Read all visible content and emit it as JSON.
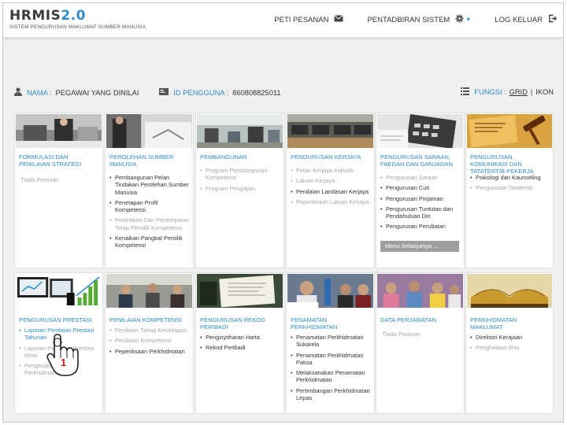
{
  "header": {
    "logo_main": "HRMIS",
    "logo_ver": "2.0",
    "logo_sub": "SISTEM PENGURUSAN MAKLUMAT SUMBER MANUSIA",
    "nav": [
      {
        "label": "PETI PESANAN",
        "icon": "envelope-icon"
      },
      {
        "label": "PENTADBIRAN SISTEM",
        "icon": "gear-icon"
      },
      {
        "label": "LOG KELUAR",
        "icon": "logout-icon"
      }
    ]
  },
  "info": {
    "name_label": "NAMA :",
    "name_value": "PEGAWAI YANG DINILAI",
    "id_label": "ID PENGGUNA :",
    "id_value": "860808825011",
    "function_label": "FUNGSI :",
    "grid_label": "GRID",
    "separator": "|",
    "icon_label": "IKON"
  },
  "colors": {
    "accent": "#2d8cc8",
    "dim_text": "#a6a6a6",
    "background": "#f0f0f0"
  },
  "cards": [
    {
      "title": "FORMULASI DAN PENILAIAN STRATEGI",
      "none": "Tiada Peranan",
      "items": []
    },
    {
      "title": "PEROLEHAN SUMBER MANUSIA",
      "items": [
        {
          "label": "Pembangunan Pelan Tindakan Perolehan Sumber Manusia",
          "dim": false
        },
        {
          "label": "Penetapan Profil Kompetensi",
          "dim": false
        },
        {
          "label": "Pelantikan Dan Penempatan Tetap Pemilik Kompetensi",
          "dim": true
        },
        {
          "label": "Kenaikan Pangkat Pemilik Kompetensi",
          "dim": false
        }
      ]
    },
    {
      "title": "PEMBANGUNAN",
      "items": [
        {
          "label": "Program Pembangunan Kompetensi",
          "dim": true
        },
        {
          "label": "Program Pengajian",
          "dim": true
        }
      ]
    },
    {
      "title": "PENGURUSAN KERJAYA",
      "items": [
        {
          "label": "Pelan Kerjaya Individu",
          "dim": true
        },
        {
          "label": "Laluan Kerjaya",
          "dim": true
        },
        {
          "label": "Penilaian Landasan Kerjaya",
          "dim": false
        },
        {
          "label": "Peperiksaan Laluan Kerjaya",
          "dim": true
        }
      ]
    },
    {
      "title": "PENGURUSAN SARAAN, FAEDAH DAN GANJARAN",
      "more": "Menu Selanjutnya ...",
      "items": [
        {
          "label": "Pengurusan Saraan",
          "dim": true
        },
        {
          "label": "Pengurusan Cuti",
          "dim": false
        },
        {
          "label": "Pengurusan Pinjaman",
          "dim": false
        },
        {
          "label": "Pengurusan Tuntutan dan Pendahuluan Diri",
          "dim": false
        },
        {
          "label": "Pengurusan Perubatan",
          "dim": false
        }
      ]
    },
    {
      "title": "PENGURUSAN KOMUNIKASI DAN TATATERTIB PEKERJA",
      "items": [
        {
          "label": "Psikologi dan Kaunseling",
          "dim": false
        },
        {
          "label": "Pengurusan Tatatertib",
          "dim": true
        }
      ]
    },
    {
      "title": "PENGURUSAN PRESTASI",
      "items": [
        {
          "label": "Laporan Penilaian Prestasi Tahunan",
          "dim": false
        },
        {
          "label": "Laporan Penilaian Prestasi Khas",
          "dim": true
        },
        {
          "label": "Pengesahan Dalam Perkhidmatan",
          "dim": true
        }
      ]
    },
    {
      "title": "PENILAIAN KOMPETENSI",
      "items": [
        {
          "label": "Penilaian Tahap Kecekapan",
          "dim": true
        },
        {
          "label": "Penilaian Kompetensi",
          "dim": true
        },
        {
          "label": "Peperiksaan Perkhidmatan",
          "dim": false
        }
      ]
    },
    {
      "title": "PENGURUSAN REKOD PERIBADI",
      "items": [
        {
          "label": "Pengisytiharan Harta",
          "dim": false
        },
        {
          "label": "Rekod Peribadi",
          "dim": false
        }
      ]
    },
    {
      "title": "PENAMATAN PERKHIDMATAN",
      "items": [
        {
          "label": "Penamatan Perkhidmatan Sukarela",
          "dim": false
        },
        {
          "label": "Penamatan Perkhidmatan Paksa",
          "dim": false
        },
        {
          "label": "Melaksanakan Penamatan Perkhidmatan",
          "dim": false
        },
        {
          "label": "Pertimbangan Perkhidmatan Lepas",
          "dim": false
        }
      ]
    },
    {
      "title": "DATA PERJAWATAN",
      "none": "Tiada Peranan",
      "items": []
    },
    {
      "title": "PERKHIDMATAN MAKLUMAT",
      "items": [
        {
          "label": "Direktori Kerajaan",
          "dim": false
        },
        {
          "label": "Penghalaan Ilmu",
          "dim": true
        }
      ]
    }
  ],
  "pointer": {
    "icon": "hand-pointer-icon",
    "badge": "1"
  }
}
